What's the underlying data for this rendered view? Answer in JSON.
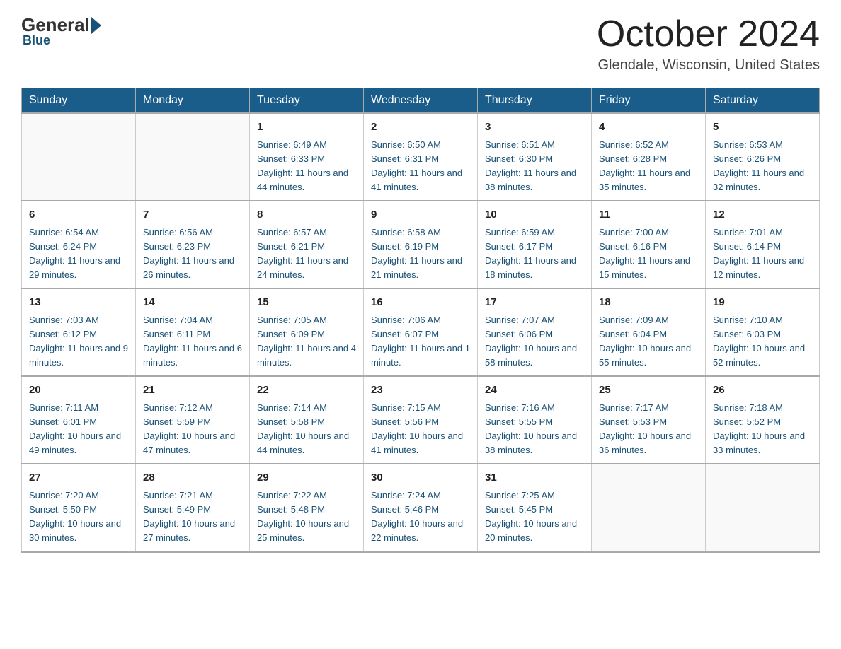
{
  "header": {
    "logo_general": "General",
    "logo_blue": "Blue",
    "month_title": "October 2024",
    "location": "Glendale, Wisconsin, United States"
  },
  "days_of_week": [
    "Sunday",
    "Monday",
    "Tuesday",
    "Wednesday",
    "Thursday",
    "Friday",
    "Saturday"
  ],
  "weeks": [
    [
      {
        "day": "",
        "sunrise": "",
        "sunset": "",
        "daylight": ""
      },
      {
        "day": "",
        "sunrise": "",
        "sunset": "",
        "daylight": ""
      },
      {
        "day": "1",
        "sunrise": "Sunrise: 6:49 AM",
        "sunset": "Sunset: 6:33 PM",
        "daylight": "Daylight: 11 hours and 44 minutes."
      },
      {
        "day": "2",
        "sunrise": "Sunrise: 6:50 AM",
        "sunset": "Sunset: 6:31 PM",
        "daylight": "Daylight: 11 hours and 41 minutes."
      },
      {
        "day": "3",
        "sunrise": "Sunrise: 6:51 AM",
        "sunset": "Sunset: 6:30 PM",
        "daylight": "Daylight: 11 hours and 38 minutes."
      },
      {
        "day": "4",
        "sunrise": "Sunrise: 6:52 AM",
        "sunset": "Sunset: 6:28 PM",
        "daylight": "Daylight: 11 hours and 35 minutes."
      },
      {
        "day": "5",
        "sunrise": "Sunrise: 6:53 AM",
        "sunset": "Sunset: 6:26 PM",
        "daylight": "Daylight: 11 hours and 32 minutes."
      }
    ],
    [
      {
        "day": "6",
        "sunrise": "Sunrise: 6:54 AM",
        "sunset": "Sunset: 6:24 PM",
        "daylight": "Daylight: 11 hours and 29 minutes."
      },
      {
        "day": "7",
        "sunrise": "Sunrise: 6:56 AM",
        "sunset": "Sunset: 6:23 PM",
        "daylight": "Daylight: 11 hours and 26 minutes."
      },
      {
        "day": "8",
        "sunrise": "Sunrise: 6:57 AM",
        "sunset": "Sunset: 6:21 PM",
        "daylight": "Daylight: 11 hours and 24 minutes."
      },
      {
        "day": "9",
        "sunrise": "Sunrise: 6:58 AM",
        "sunset": "Sunset: 6:19 PM",
        "daylight": "Daylight: 11 hours and 21 minutes."
      },
      {
        "day": "10",
        "sunrise": "Sunrise: 6:59 AM",
        "sunset": "Sunset: 6:17 PM",
        "daylight": "Daylight: 11 hours and 18 minutes."
      },
      {
        "day": "11",
        "sunrise": "Sunrise: 7:00 AM",
        "sunset": "Sunset: 6:16 PM",
        "daylight": "Daylight: 11 hours and 15 minutes."
      },
      {
        "day": "12",
        "sunrise": "Sunrise: 7:01 AM",
        "sunset": "Sunset: 6:14 PM",
        "daylight": "Daylight: 11 hours and 12 minutes."
      }
    ],
    [
      {
        "day": "13",
        "sunrise": "Sunrise: 7:03 AM",
        "sunset": "Sunset: 6:12 PM",
        "daylight": "Daylight: 11 hours and 9 minutes."
      },
      {
        "day": "14",
        "sunrise": "Sunrise: 7:04 AM",
        "sunset": "Sunset: 6:11 PM",
        "daylight": "Daylight: 11 hours and 6 minutes."
      },
      {
        "day": "15",
        "sunrise": "Sunrise: 7:05 AM",
        "sunset": "Sunset: 6:09 PM",
        "daylight": "Daylight: 11 hours and 4 minutes."
      },
      {
        "day": "16",
        "sunrise": "Sunrise: 7:06 AM",
        "sunset": "Sunset: 6:07 PM",
        "daylight": "Daylight: 11 hours and 1 minute."
      },
      {
        "day": "17",
        "sunrise": "Sunrise: 7:07 AM",
        "sunset": "Sunset: 6:06 PM",
        "daylight": "Daylight: 10 hours and 58 minutes."
      },
      {
        "day": "18",
        "sunrise": "Sunrise: 7:09 AM",
        "sunset": "Sunset: 6:04 PM",
        "daylight": "Daylight: 10 hours and 55 minutes."
      },
      {
        "day": "19",
        "sunrise": "Sunrise: 7:10 AM",
        "sunset": "Sunset: 6:03 PM",
        "daylight": "Daylight: 10 hours and 52 minutes."
      }
    ],
    [
      {
        "day": "20",
        "sunrise": "Sunrise: 7:11 AM",
        "sunset": "Sunset: 6:01 PM",
        "daylight": "Daylight: 10 hours and 49 minutes."
      },
      {
        "day": "21",
        "sunrise": "Sunrise: 7:12 AM",
        "sunset": "Sunset: 5:59 PM",
        "daylight": "Daylight: 10 hours and 47 minutes."
      },
      {
        "day": "22",
        "sunrise": "Sunrise: 7:14 AM",
        "sunset": "Sunset: 5:58 PM",
        "daylight": "Daylight: 10 hours and 44 minutes."
      },
      {
        "day": "23",
        "sunrise": "Sunrise: 7:15 AM",
        "sunset": "Sunset: 5:56 PM",
        "daylight": "Daylight: 10 hours and 41 minutes."
      },
      {
        "day": "24",
        "sunrise": "Sunrise: 7:16 AM",
        "sunset": "Sunset: 5:55 PM",
        "daylight": "Daylight: 10 hours and 38 minutes."
      },
      {
        "day": "25",
        "sunrise": "Sunrise: 7:17 AM",
        "sunset": "Sunset: 5:53 PM",
        "daylight": "Daylight: 10 hours and 36 minutes."
      },
      {
        "day": "26",
        "sunrise": "Sunrise: 7:18 AM",
        "sunset": "Sunset: 5:52 PM",
        "daylight": "Daylight: 10 hours and 33 minutes."
      }
    ],
    [
      {
        "day": "27",
        "sunrise": "Sunrise: 7:20 AM",
        "sunset": "Sunset: 5:50 PM",
        "daylight": "Daylight: 10 hours and 30 minutes."
      },
      {
        "day": "28",
        "sunrise": "Sunrise: 7:21 AM",
        "sunset": "Sunset: 5:49 PM",
        "daylight": "Daylight: 10 hours and 27 minutes."
      },
      {
        "day": "29",
        "sunrise": "Sunrise: 7:22 AM",
        "sunset": "Sunset: 5:48 PM",
        "daylight": "Daylight: 10 hours and 25 minutes."
      },
      {
        "day": "30",
        "sunrise": "Sunrise: 7:24 AM",
        "sunset": "Sunset: 5:46 PM",
        "daylight": "Daylight: 10 hours and 22 minutes."
      },
      {
        "day": "31",
        "sunrise": "Sunrise: 7:25 AM",
        "sunset": "Sunset: 5:45 PM",
        "daylight": "Daylight: 10 hours and 20 minutes."
      },
      {
        "day": "",
        "sunrise": "",
        "sunset": "",
        "daylight": ""
      },
      {
        "day": "",
        "sunrise": "",
        "sunset": "",
        "daylight": ""
      }
    ]
  ]
}
